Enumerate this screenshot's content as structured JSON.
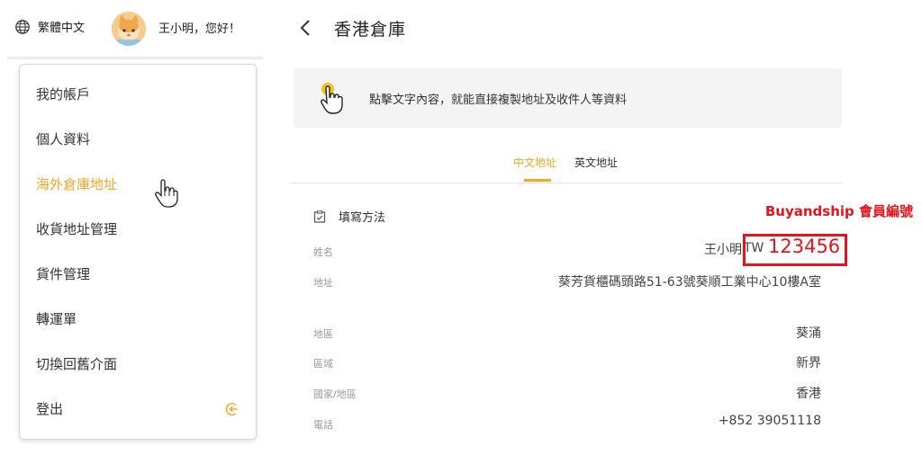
{
  "header": {
    "language": "繁體中文",
    "greeting": "王小明，您好！"
  },
  "sidebar": {
    "items": [
      {
        "label": "我的帳戶"
      },
      {
        "label": "個人資料"
      },
      {
        "label": "海外倉庫地址"
      },
      {
        "label": "收貨地址管理"
      },
      {
        "label": "貨件管理"
      },
      {
        "label": "轉運單"
      },
      {
        "label": "切換回舊介面"
      },
      {
        "label": "登出"
      }
    ],
    "active_index": 2
  },
  "main": {
    "title": "香港倉庫",
    "hint": "點擊文字內容，就能直接複製地址及收件人等資料",
    "tabs": [
      {
        "label": "中文地址"
      },
      {
        "label": "英文地址"
      }
    ],
    "method_label": "填寫方法",
    "member_annotation": "Buyandship 會員編號",
    "fields": {
      "name_label": "姓名",
      "name_value": "王小明",
      "member_prefix": "TW",
      "member_number": "123456",
      "address_label": "地址",
      "address_value": "葵芳貨櫃碼頭路51-63號葵順工業中心10樓A室",
      "district_label": "地區",
      "district_value": "葵涌",
      "region_label": "區域",
      "region_value": "新界",
      "country_label": "國家/地區",
      "country_value": "香港",
      "phone_label": "電話",
      "phone_value": "+852 39051118"
    }
  },
  "colors": {
    "accent": "#f5a623",
    "annotation_red": "#e8141c"
  }
}
